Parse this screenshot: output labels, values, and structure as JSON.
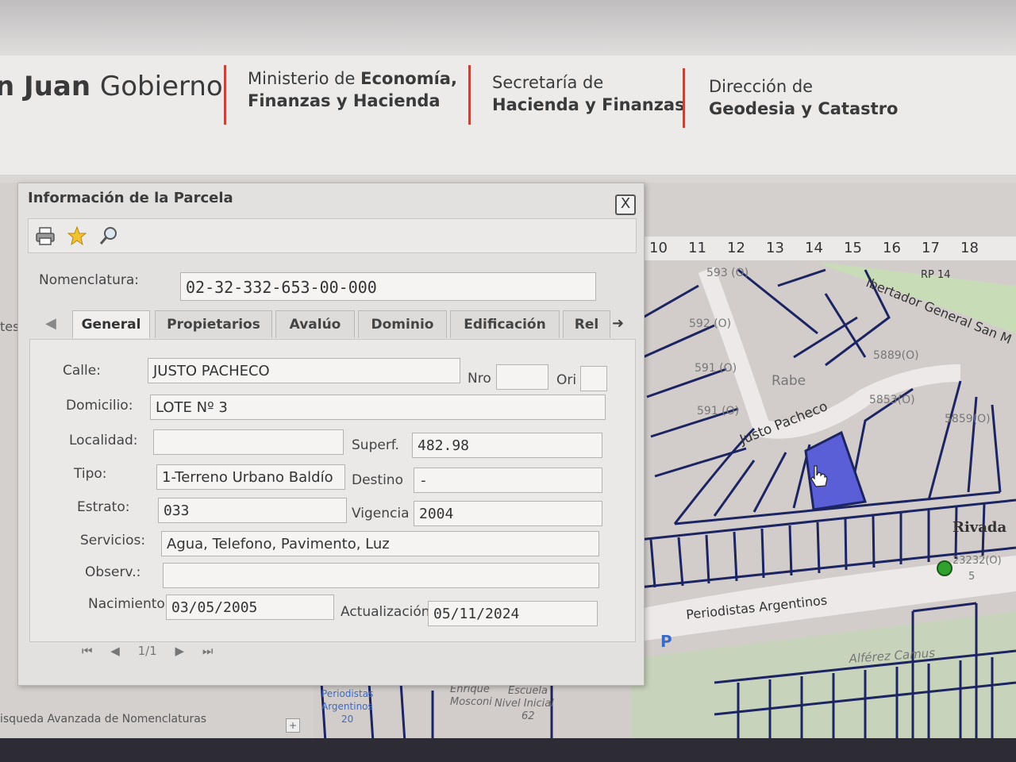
{
  "header": {
    "gobierno_bold": "n Juan",
    "gobierno_light": "Gobierno",
    "ministerio_line1_light": "Ministerio de",
    "ministerio_line1_bold": "Economía,",
    "ministerio_line2": "Finanzas y Hacienda",
    "secretaria_line1": "Secretaría  de",
    "secretaria_line2": "Hacienda y Finanzas",
    "direccion_line1": "Dirección de",
    "direccion_line2": "Geodesia y Catastro",
    "separator_color": "#c0463a"
  },
  "sidebar": {
    "partial_label": "tes",
    "busqueda_label": "isqueda Avanzada de Nomenclaturas",
    "plus_label": "+"
  },
  "dialog": {
    "title": "Información de la Parcela",
    "close_label": "X",
    "toolbar_icons": [
      "print-icon",
      "star-icon",
      "search-icon"
    ],
    "nomenclatura_label": "Nomenclatura:",
    "nomenclatura_value": "02-32-332-653-00-000",
    "tabs": [
      {
        "label": "General",
        "active": true
      },
      {
        "label": "Propietarios",
        "active": false
      },
      {
        "label": "Avalúo",
        "active": false
      },
      {
        "label": "Dominio",
        "active": false
      },
      {
        "label": "Edificación",
        "active": false
      },
      {
        "label": "Rel",
        "active": false
      }
    ],
    "fields": {
      "calle_label": "Calle:",
      "calle_value": "JUSTO PACHECO",
      "nro_label": "Nro",
      "nro_value": "",
      "ori_label": "Ori",
      "ori_value": "",
      "domicilio_label": "Domicilio:",
      "domicilio_value": "LOTE Nº 3",
      "localidad_label": "Localidad:",
      "localidad_value": "",
      "superf_label": "Superf.",
      "superf_value": "482.98",
      "tipo_label": "Tipo:",
      "tipo_value": "1-Terreno Urbano Baldío",
      "destino_label": "Destino",
      "destino_value": "-",
      "estrato_label": "Estrato:",
      "estrato_value": "033",
      "vigencia_label": "Vigencia",
      "vigencia_value": "2004",
      "servicios_label": "Servicios:",
      "servicios_value": "Agua, Telefono, Pavimento, Luz",
      "observ_label": "Observ.:",
      "observ_value": "",
      "nacimiento_label": "Nacimiento:",
      "nacimiento_value": "03/05/2005",
      "actualizacion_label": "Actualización",
      "actualizacion_value": "05/11/2024"
    },
    "pager": {
      "first": "⏮",
      "prev": "◀",
      "page": "1/1",
      "next": "▶",
      "last": "⏭"
    }
  },
  "map": {
    "ruler_ticks": [
      "10",
      "11",
      "12",
      "13",
      "14",
      "15",
      "16",
      "17",
      "18"
    ],
    "street_labels": {
      "justo_pacheco": "Justo Pacheco",
      "periodistas": "Periodistas Argentinos",
      "libertador": "ibertador General San M",
      "rabe": "Rabe",
      "rivadavia": "Rivada",
      "alferez": "Alférez Camus",
      "rp14": "RP 14",
      "parking": "P"
    },
    "parcel_labels": [
      "593 (O)",
      "592 (O)",
      "591 (O)",
      "591 (O)",
      "5889(O)",
      "5853(O)",
      "5859(O)",
      "23232(O)",
      "5"
    ],
    "bottom_labels": {
      "enrique": "Enrique",
      "mosconi": "Mosconi",
      "escuela": "Escuela",
      "nivel": "Nivel Inicial",
      "num62": "62",
      "periodistas_small": "Periodistas",
      "argentinos_small": "Argentinos",
      "num20": "20"
    },
    "highlight_color": "#5a5fd8",
    "line_color": "#1c2462",
    "marker_color": "#2fa12f"
  }
}
